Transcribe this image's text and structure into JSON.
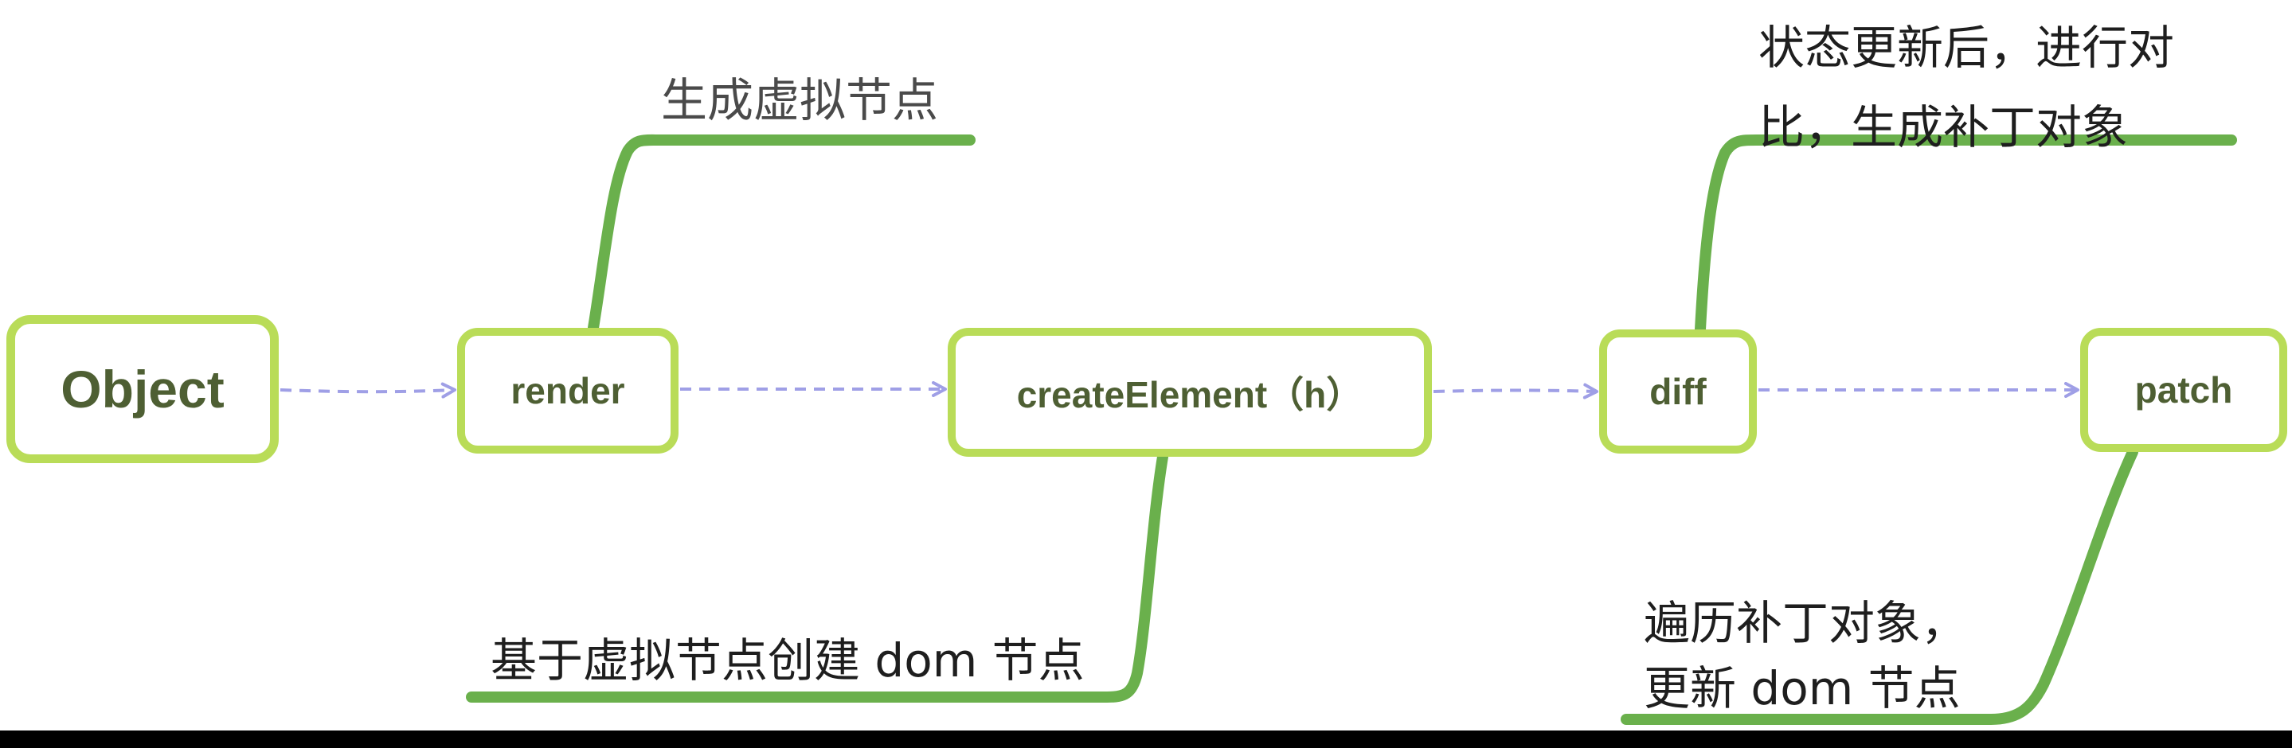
{
  "colors": {
    "node_border": "#b9dc58",
    "node_text": "#4e5f33",
    "branch_line": "#6ab04c",
    "arrow": "#9f9fe6",
    "bottom_bar": "#000000"
  },
  "nodes": {
    "object": "Object",
    "render": "render",
    "create_element": "createElement（h）",
    "diff": "diff",
    "patch": "patch"
  },
  "labels": {
    "render": "生成虚拟节点",
    "diff": {
      "line1": "状态更新后，进行对",
      "line2": "比，生成补丁对象"
    },
    "create_element": "基于虚拟节点创建 dom 节点",
    "patch": {
      "line1": "遍历补丁对象，",
      "line2": "更新 dom 节点"
    }
  }
}
